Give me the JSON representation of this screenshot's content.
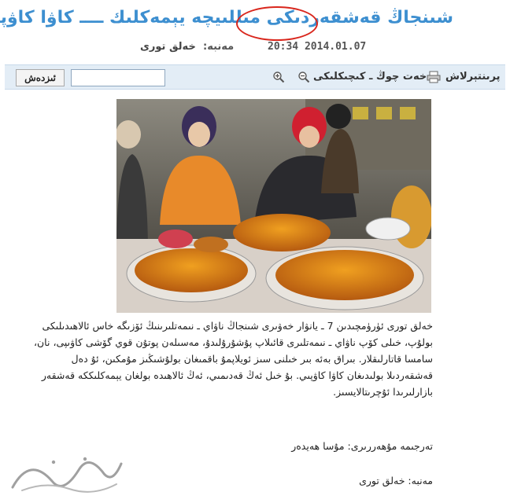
{
  "article": {
    "title": "شىنجاڭ قەشقەردىكى مىللىيچە يېمەكلىك ــــ كاۋا كاۋپىي",
    "source_label": "مەنبە:",
    "source": "خەلق تورى",
    "date": "20:34 2014.01.07"
  },
  "toolbar": {
    "print_label": "پرىنتېرلاش",
    "font_size_label": "خەت چوڭ ـ كىچىكلىكى",
    "search_button_label": "ئىزدەش",
    "search_value": "",
    "icons": [
      "print-icon",
      "zoom-out-icon",
      "zoom-in-icon"
    ]
  },
  "photo": {
    "subject": "market vendors with roasted pumpkin"
  },
  "body": {
    "paragraph": "خەلق تورى ئۈرۈمچىدىن 7 ـ يانۋار خەۋىرى شىنجاڭ ناۋاي ـ نىمەتلىرىنىڭ ئۆزىگە خاس ئالاھىدىلىكى بولۇپ، خىلى كۆپ ناۋاي ـ نىمەتلىرى قائىلاپ پۇشۇرۇلىدۇ، مەسىلەن پوتۇن قوي گۆشى كاۋىپى، نان، سامسا قاتارلىقلار. بىراق بەئە بىر خىلنى سىز ئويلاپمۇ باقمىغان بولۇشىڭىز مۇمكىن، ئۇ دەل قەشقەردىلا بولىدىغان كاۋا كاۋپىي. بۇ خىل ئەڭ قەدىمىي، ئەڭ ئالاھىدە بولغان يېمەكلىككە قەشقەر بازارلىرىدا ئۇچرىتالايسىز.",
    "translator": "تەرجىمە مۇھەررىرى: مۇسا ھەيدەر",
    "footer_source": "مەنبە: خەلق تورى"
  },
  "watermark": {
    "logo_text": "سازتورى"
  },
  "colors": {
    "title": "#3d8fd0",
    "title_circle": "#d9261c",
    "toolbar_bg": "#e3edf6"
  }
}
